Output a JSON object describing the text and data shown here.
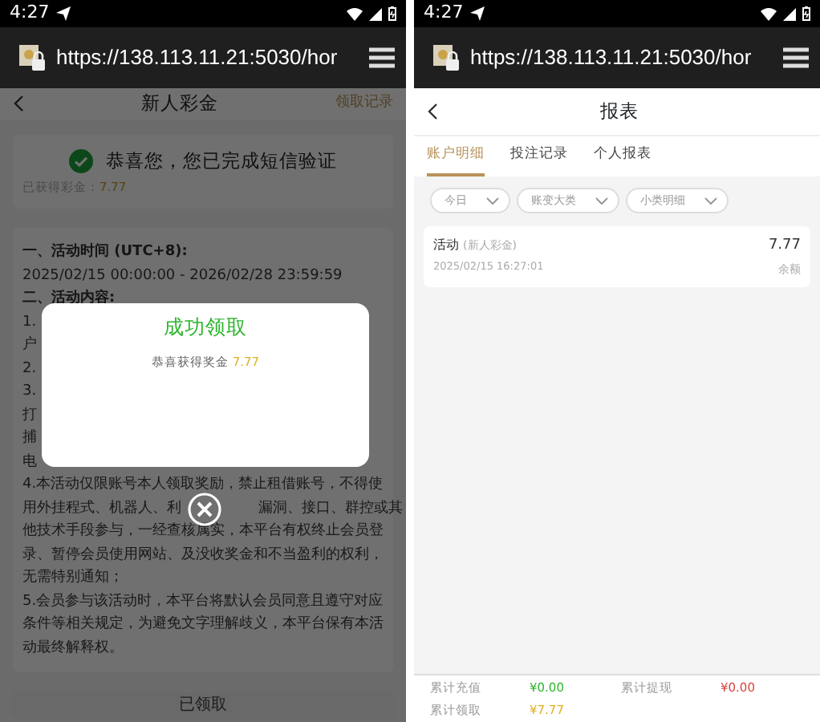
{
  "left_screen": {
    "status_bar": {
      "time": "4:27"
    },
    "browser": {
      "url": "https://138.113.11.21:5030/hor"
    },
    "header": {
      "title": "新人彩金",
      "action": "领取记录"
    },
    "notice": {
      "text": "恭喜您，您已完成短信验证",
      "label": "已获得彩金：",
      "amount": "7.77"
    },
    "rules": [
      {
        "kind": "heading",
        "parts": [
          "一、活动时间 (UTC+8):"
        ]
      },
      {
        "kind": "text",
        "parts": [
          "2025/02/15 00:00:00 - 2026/02/28 23:59:59"
        ]
      },
      {
        "kind": "heading",
        "parts": [
          "二、活动内容:"
        ]
      },
      {
        "kind": "text",
        "parts": [
          "1."
        ]
      },
      {
        "kind": "text",
        "parts": [
          "户"
        ]
      },
      {
        "kind": "text",
        "parts": [
          "2."
        ]
      },
      {
        "kind": "text",
        "parts": [
          "3."
        ]
      },
      {
        "kind": "text",
        "parts": [
          "打"
        ]
      },
      {
        "kind": "text",
        "parts": [
          "捕"
        ]
      },
      {
        "kind": "text",
        "parts": [
          "电"
        ]
      },
      {
        "kind": "text",
        "parts": [
          "4.本活动仅限账号本人领取奖励，禁止租借账号，不得使"
        ]
      },
      {
        "kind": "text",
        "parts": [
          "用外挂程式、机器人、利",
          "漏洞、接口、群控或其"
        ]
      },
      {
        "kind": "text",
        "parts": [
          "他技术手段参与，一经查核属实，本平台有权终止会员登"
        ]
      },
      {
        "kind": "text",
        "parts": [
          "录、暂停会员使用网站、及没收奖金和不当盈利的权利，"
        ]
      },
      {
        "kind": "text",
        "parts": [
          "无需特别通知；"
        ]
      },
      {
        "kind": "text",
        "parts": [
          "5.会员参与该活动时，本平台将默认会员同意且遵守对应"
        ]
      },
      {
        "kind": "text",
        "parts": [
          "条件等相关规定，为避免文字理解歧义，本平台保有本活"
        ]
      },
      {
        "kind": "text",
        "parts": [
          "动最终解释权。"
        ]
      }
    ],
    "claim_button": {
      "label": "已领取",
      "disabled": true
    },
    "modal": {
      "title": "成功领取",
      "message": "恭喜获得奖金",
      "amount": "7.77"
    }
  },
  "right_screen": {
    "status_bar": {
      "time": "4:27"
    },
    "browser": {
      "url": "https://138.113.11.21:5030/hor"
    },
    "header": {
      "title": "报表"
    },
    "tabs": [
      {
        "label": "账户明细",
        "selected": true
      },
      {
        "label": "投注记录",
        "selected": false
      },
      {
        "label": "个人报表",
        "selected": false
      }
    ],
    "filters": [
      "今日",
      "账变大类",
      "小类明细"
    ],
    "records": [
      {
        "title": "活动",
        "tag": "(新人彩金)",
        "time": "2025/02/15 16:27:01",
        "amount": "7.77",
        "type": "余额"
      }
    ],
    "summary": [
      {
        "label": "累计充值",
        "value": "¥0.00",
        "color": "#2db52d"
      },
      {
        "label": "累计提现",
        "value": "¥0.00",
        "color": "#d9443c"
      },
      {
        "label": "累计领取",
        "value": "¥7.77",
        "color": "#e0b020"
      }
    ]
  }
}
